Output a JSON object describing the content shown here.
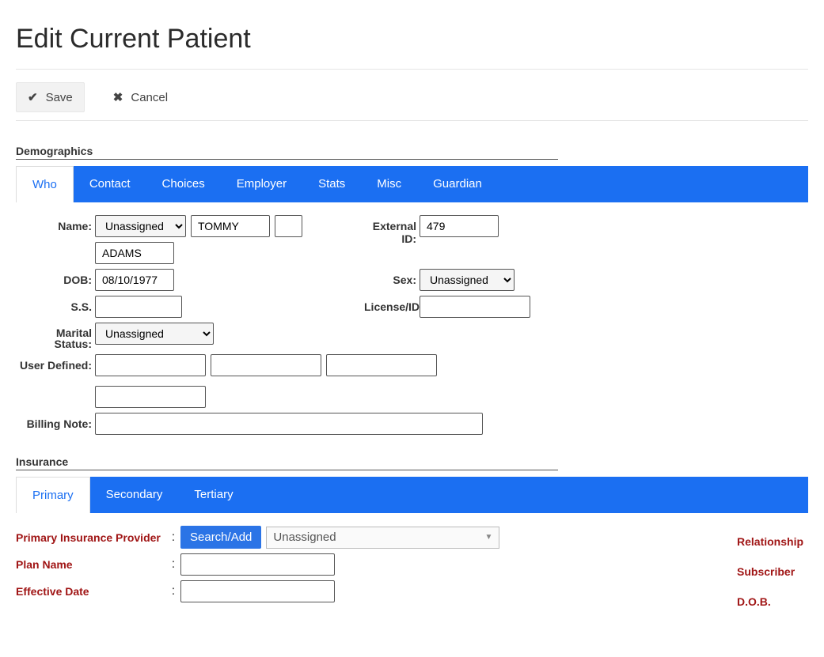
{
  "page": {
    "title": "Edit Current Patient"
  },
  "actions": {
    "save_label": "Save",
    "cancel_label": "Cancel"
  },
  "sections": {
    "demographics_title": "Demographics",
    "insurance_title": "Insurance"
  },
  "tabs_demo": {
    "who": "Who",
    "contact": "Contact",
    "choices": "Choices",
    "employer": "Employer",
    "stats": "Stats",
    "misc": "Misc",
    "guardian": "Guardian"
  },
  "labels": {
    "name": "Name:",
    "external_id": "External ID:",
    "dob": "DOB:",
    "sex": "Sex:",
    "ss": "S.S.",
    "license": "License/ID:",
    "marital": "Marital Status:",
    "user_defined": "User Defined:",
    "billing_note": "Billing Note:"
  },
  "patient": {
    "title_selected": "Unassigned",
    "first_name": "TOMMY",
    "middle_name": "",
    "last_name": "ADAMS",
    "external_id": "479",
    "dob": "08/10/1977",
    "sex_selected": "Unassigned",
    "ssn": "",
    "license_id": "",
    "marital_selected": "Unassigned",
    "user_defined_1": "",
    "user_defined_2": "",
    "user_defined_3": "",
    "user_defined_4": "",
    "billing_note": ""
  },
  "tabs_ins": {
    "primary": "Primary",
    "secondary": "Secondary",
    "tertiary": "Tertiary"
  },
  "insurance": {
    "provider_label": "Primary Insurance Provider",
    "plan_label": "Plan Name",
    "eff_label": "Effective Date",
    "search_add": "Search/Add",
    "provider_selected": "Unassigned",
    "plan_value": "",
    "eff_value": "",
    "right": {
      "relationship": "Relationship",
      "subscriber": "Subscriber",
      "dob": "D.O.B."
    }
  }
}
